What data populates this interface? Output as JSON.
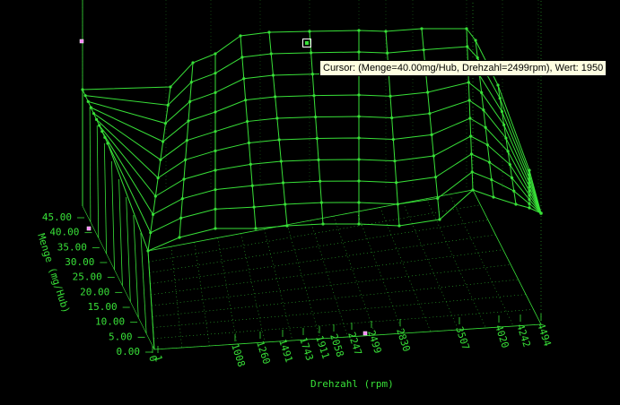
{
  "tooltip": "Cursor: (Menge=40.00mg/Hub, Drehzahl=2499rpm), Wert: 1950",
  "colors": {
    "background": "#000000",
    "mesh": "#38e038",
    "tooltip_bg": "#ffffe1",
    "marker": "#ff80ff"
  },
  "axes": {
    "y": {
      "title": "Menge (mg/Hub)",
      "ticks": [
        "45.00",
        "40.00",
        "35.00",
        "30.00",
        "25.00",
        "20.00",
        "15.00",
        "10.00",
        "5.00",
        "0.00"
      ]
    },
    "x": {
      "title": "Drehzahl (rpm)",
      "ticks": [
        "0",
        "1",
        "1008",
        "1260",
        "1491",
        "1743",
        "1911",
        "2058",
        "2247",
        "2499",
        "2830",
        "3507",
        "4020",
        "4242",
        "4494"
      ]
    }
  },
  "chart_data": {
    "type": "surface",
    "xlabel": "Drehzahl (rpm)",
    "ylabel": "Menge (mg/Hub)",
    "x": [
      0,
      1,
      1008,
      1260,
      1491,
      1743,
      1911,
      2058,
      2247,
      2499,
      2830,
      3507,
      4020,
      4242,
      4494
    ],
    "y": [
      0,
      5,
      10,
      15,
      20,
      25,
      30,
      35,
      40,
      45
    ],
    "cursor": {
      "menge": 40.0,
      "drehzahl": 2499,
      "wert": 1950
    }
  }
}
